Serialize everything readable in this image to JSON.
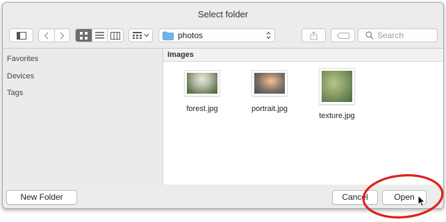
{
  "dialog": {
    "title": "Select folder"
  },
  "toolbar": {
    "location": {
      "label": "photos",
      "icon": "folder-icon",
      "color": "#6cb6f0"
    },
    "search": {
      "placeholder": "Search"
    }
  },
  "sidebar": {
    "items": [
      {
        "label": "Favorites"
      },
      {
        "label": "Devices"
      },
      {
        "label": "Tags"
      }
    ]
  },
  "content": {
    "header": "Images",
    "files": [
      {
        "name": "forest.jpg"
      },
      {
        "name": "portrait.jpg"
      },
      {
        "name": "texture.jpg"
      }
    ]
  },
  "footer": {
    "new_folder_label": "New Folder",
    "cancel_label": "Cancel",
    "open_label": "Open"
  },
  "annotation": {
    "color": "#e0201a"
  }
}
